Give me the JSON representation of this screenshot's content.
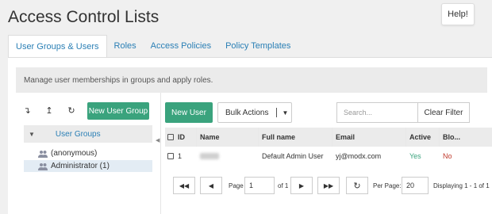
{
  "page": {
    "title": "Access Control Lists",
    "help_label": "Help!"
  },
  "tabs": [
    {
      "label": "User Groups & Users",
      "active": true
    },
    {
      "label": "Roles"
    },
    {
      "label": "Access Policies"
    },
    {
      "label": "Policy Templates"
    }
  ],
  "description": "Manage user memberships in groups and apply roles.",
  "tree": {
    "toolbar": {
      "expand_icon": "↴",
      "collapse_icon": "↥",
      "refresh_icon": "↻",
      "new_group_label": "New User Group"
    },
    "root_label": "User Groups",
    "nodes": [
      {
        "label": "(anonymous)"
      },
      {
        "label": "Administrator (1)",
        "selected": true
      }
    ]
  },
  "grid": {
    "new_user_label": "New User",
    "bulk_actions_label": "Bulk Actions",
    "search_placeholder": "Search...",
    "clear_filter_label": "Clear Filter",
    "columns": [
      "ID",
      "Name",
      "Full name",
      "Email",
      "Active",
      "Blo..."
    ],
    "rows": [
      {
        "id": "1",
        "name": "",
        "fullname": "Default Admin User",
        "email": "yj@modx.com",
        "active": "Yes",
        "blocked": "No"
      }
    ]
  },
  "pager": {
    "page_label": "Page",
    "page_value": "1",
    "of_label": "of 1",
    "per_page_label": "Per Page:",
    "per_page_value": "20",
    "displaying": "Displaying 1 - 1 of 1"
  },
  "colors": {
    "accent_green": "#3aa37d",
    "link_blue": "#2a7fb5",
    "no_red": "#c0392b"
  }
}
